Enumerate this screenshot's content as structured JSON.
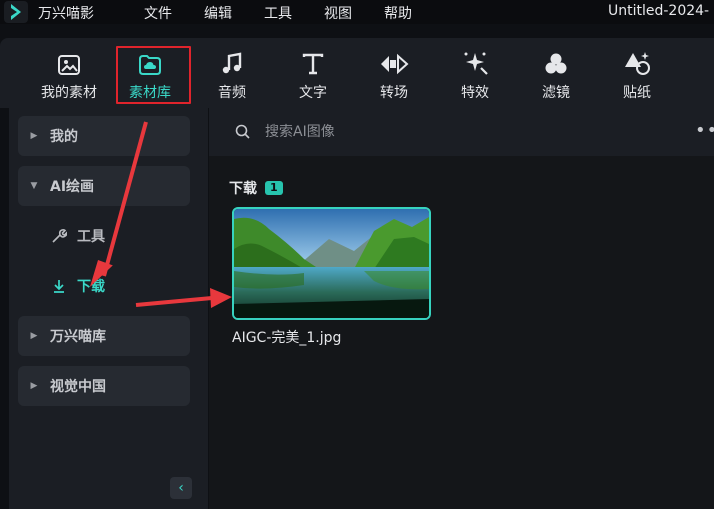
{
  "titlebar": {
    "app_name": "万兴喵影",
    "menus": [
      "文件",
      "编辑",
      "工具",
      "视图",
      "帮助"
    ],
    "doc_title": "Untitled-2024-"
  },
  "toolbar": {
    "items": [
      {
        "label": "我的素材",
        "icon": "image-icon"
      },
      {
        "label": "素材库",
        "icon": "cloud-folder-icon",
        "active": true
      },
      {
        "label": "音频",
        "icon": "music-note-icon"
      },
      {
        "label": "文字",
        "icon": "text-t-icon"
      },
      {
        "label": "转场",
        "icon": "transition-icon"
      },
      {
        "label": "特效",
        "icon": "sparkle-icon"
      },
      {
        "label": "滤镜",
        "icon": "filter-circles-icon"
      },
      {
        "label": "贴纸",
        "icon": "sticker-icon"
      }
    ]
  },
  "sidebar": {
    "items": [
      {
        "label": "我的"
      },
      {
        "label": "AI绘画",
        "expanded": true
      },
      {
        "label": "万兴喵库"
      },
      {
        "label": "视觉中国"
      }
    ],
    "sub_items": [
      {
        "label": "工具",
        "icon": "wrench-icon"
      },
      {
        "label": "下载",
        "icon": "download-icon",
        "active": true
      }
    ]
  },
  "search": {
    "placeholder": "搜索AI图像",
    "value": ""
  },
  "main": {
    "section_title": "下载",
    "section_count": "1",
    "thumbnail_name": "AIGC-完美_1.jpg"
  },
  "colors": {
    "accent": "#3ad8c8",
    "highlight_box": "#e0242c",
    "arrow": "#e8383d"
  }
}
